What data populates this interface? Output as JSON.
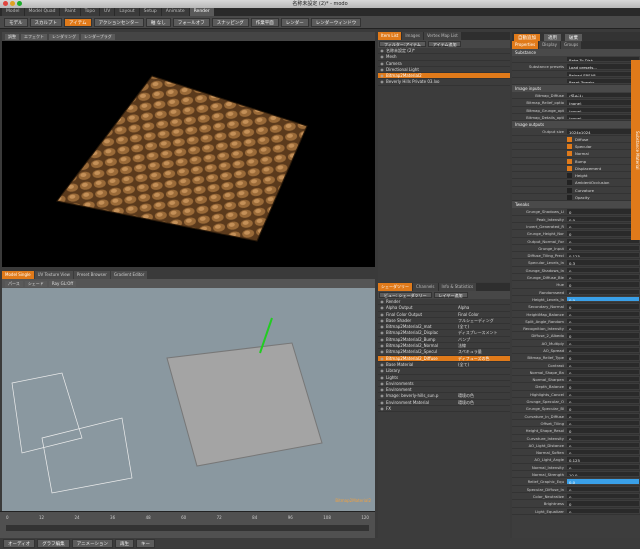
{
  "window": {
    "title": "名称未設定 (2)* - modo"
  },
  "tabs": [
    "Model",
    "Model Quad",
    "Paint",
    "Topo",
    "UV",
    "Layout",
    "Setup",
    "Animate",
    "Render"
  ],
  "tabs_active": "Render",
  "toolbar": [
    "モデル",
    "スカルプト",
    "アイテム",
    "アクションセンター",
    "軸 なし",
    "フォールオフ",
    "スナッピング",
    "作業平面",
    "レンダー",
    "レンダーウィンドウ"
  ],
  "viewport_top": {
    "buttons": [
      "調整",
      "エフェクト",
      "レンダリング",
      "レンダープラグ"
    ]
  },
  "viewport_bottom": {
    "tabs": [
      "Model Single",
      "UV Texture View",
      "Preset Browser",
      "Gradient Editor"
    ],
    "buttons": [
      "パース",
      "シェード",
      "Ray GL:Off"
    ],
    "label": "Bitmap2Material2"
  },
  "items_panel": {
    "tabs": [
      "Item List",
      "Images",
      "Vertex Map List"
    ],
    "filter": "フィルター:アイテム",
    "add": "アイテム追加",
    "rows": [
      "名称未設定 (2)*",
      "Mesh",
      "Camera",
      "Directional Light",
      "Bitmap2Material2",
      "Beverly Hills Private 03.lxo"
    ],
    "selected": "Bitmap2Material2"
  },
  "shader_panel": {
    "tabs": [
      "シェーダツリー",
      "Channels",
      "Info & Statistics"
    ],
    "view": "ビュー: シェーダツリー",
    "add": "レイヤー追加",
    "rows": [
      [
        "Render",
        ""
      ],
      [
        "Alpha Output",
        "Alpha"
      ],
      [
        "Final Color Output",
        "Final Color"
      ],
      [
        "Base Shader",
        "フルシェーディング"
      ],
      [
        "Bitmap2Material2_mat",
        "(全て)"
      ],
      [
        "Bitmap2Material2_Displac",
        "ディスプレースメント"
      ],
      [
        "Bitmap2Material2_Bump",
        "バンプ"
      ],
      [
        "Bitmap2Material2_Normal",
        "法線"
      ],
      [
        "Bitmap2Material2_Specul",
        "スペキュラ量"
      ],
      [
        "Bitmap2Material2_Diffuse",
        "ディフューズの色"
      ],
      [
        "Base Material",
        "(全て)"
      ],
      [
        "Library",
        ""
      ],
      [
        "Lights",
        ""
      ],
      [
        "Environments",
        ""
      ],
      [
        "Environment",
        ""
      ],
      [
        "Image: beverly-hills_sun.p",
        "環境の色"
      ],
      [
        "Environment Material",
        "環境の色"
      ],
      [
        "FX",
        ""
      ]
    ],
    "selected": "Bitmap2Material2_Diffuse"
  },
  "props": {
    "preset": "プリセット",
    "top_buttons": [
      "自動追加",
      "適用",
      "破棄"
    ],
    "tabs": [
      "Properties",
      "Display",
      "Groups"
    ],
    "substance": "Substance",
    "bake": "Bake To Disk",
    "presets_label": "Substance presets",
    "presets_val": "Load presets...",
    "reload": "Reload SBSAR",
    "reset": "Reset Tweaks",
    "image_inputs": "Image inputs",
    "inputs": [
      [
        "Bitmap_Diffuse",
        "(読み込)"
      ],
      [
        "Bitmap_Relief_optio",
        "(none)"
      ],
      [
        "Bitmap_Grunge_opt",
        "(none)"
      ],
      [
        "Bitmap_Details_opti",
        "(none)"
      ]
    ],
    "image_outputs": "Image outputs",
    "output_size_label": "Output size",
    "output_size": "1024x1024",
    "outputs": [
      [
        "Diffuse",
        true
      ],
      [
        "Specular",
        true
      ],
      [
        "Normal",
        true
      ],
      [
        "Bump",
        true
      ],
      [
        "Displacement",
        true
      ],
      [
        "Height",
        false
      ],
      [
        "AmbientOcclusion",
        false
      ],
      [
        "Curvature",
        false
      ],
      [
        "Opacity",
        false
      ]
    ],
    "tweaks": "Tweaks",
    "params": [
      [
        "Grunge_Shadows_Li",
        "0"
      ],
      [
        "Peak_Intensity",
        "0.0"
      ],
      [
        "Invert_Generated_R",
        "0"
      ],
      [
        "Grunge_Height_Nor",
        "0"
      ],
      [
        "Output_Normal_For",
        "0"
      ],
      [
        "Grunge_Input",
        "0"
      ],
      [
        "Diffuse_Tiling_Preci",
        "0.125"
      ],
      [
        "Specular_Levels_In",
        "0.3"
      ],
      [
        "Grunge_Shadows_In",
        "0"
      ],
      [
        "Grunge_Diffuse_Ble",
        "0"
      ],
      [
        "Hue",
        "0"
      ],
      [
        "Randomseed",
        "0"
      ],
      [
        "Height_Levels_In",
        "0.0"
      ],
      [
        "Secondary_Normal",
        "0"
      ],
      [
        "HeightMap_Balance",
        "0"
      ],
      [
        "Split_Angle_Random",
        "0"
      ],
      [
        "Recognition_Intensity",
        "0"
      ],
      [
        "Diffuse_2_Albedo",
        "0"
      ],
      [
        "AO_Multiply",
        "0"
      ],
      [
        "AO_Spread",
        "0"
      ],
      [
        "Bitmap_Relief_Type",
        "0"
      ],
      [
        "Contrast",
        "0"
      ],
      [
        "Normal_Shape_Bn",
        "0"
      ],
      [
        "Normal_Sharpen",
        "0"
      ],
      [
        "Depth_Balance",
        "0"
      ],
      [
        "Highlights_Cancel",
        "0"
      ],
      [
        "Grunge_Specular_O",
        "0"
      ],
      [
        "Grunge_Specular_Bl",
        "0"
      ],
      [
        "Curvature_In_Diffuse",
        "0"
      ],
      [
        "Offset_Tiling",
        "0"
      ],
      [
        "Height_Shape_Resol",
        "0"
      ],
      [
        "Curvature_Intensity",
        "0"
      ],
      [
        "AO_Light_Distance",
        "0"
      ],
      [
        "Normal_Soften",
        "0"
      ],
      [
        "AO_Light_Angle",
        "0.125"
      ],
      [
        "Normal_Intensity",
        "0"
      ],
      [
        "Normal_Strength",
        "10.0"
      ],
      [
        "Relief_Graphic_Equ",
        "0.0"
      ],
      [
        "Specular_Diffuse_In",
        "0"
      ],
      [
        "Color_Neutralize",
        "0"
      ],
      [
        "Brightness",
        "0"
      ],
      [
        "Light_Equalizer",
        "0"
      ]
    ],
    "blue_rows": [
      "Height_Levels_In",
      "Relief_Graphic_Equ"
    ],
    "side_tab": "Substance Material"
  },
  "timeline": {
    "ticks": [
      "0",
      "12",
      "24",
      "36",
      "48",
      "60",
      "72",
      "84",
      "96",
      "108",
      "120"
    ]
  },
  "bottombar": [
    "オーディオ",
    "グラフ編集",
    "アニメーション",
    "再生",
    "キー"
  ]
}
